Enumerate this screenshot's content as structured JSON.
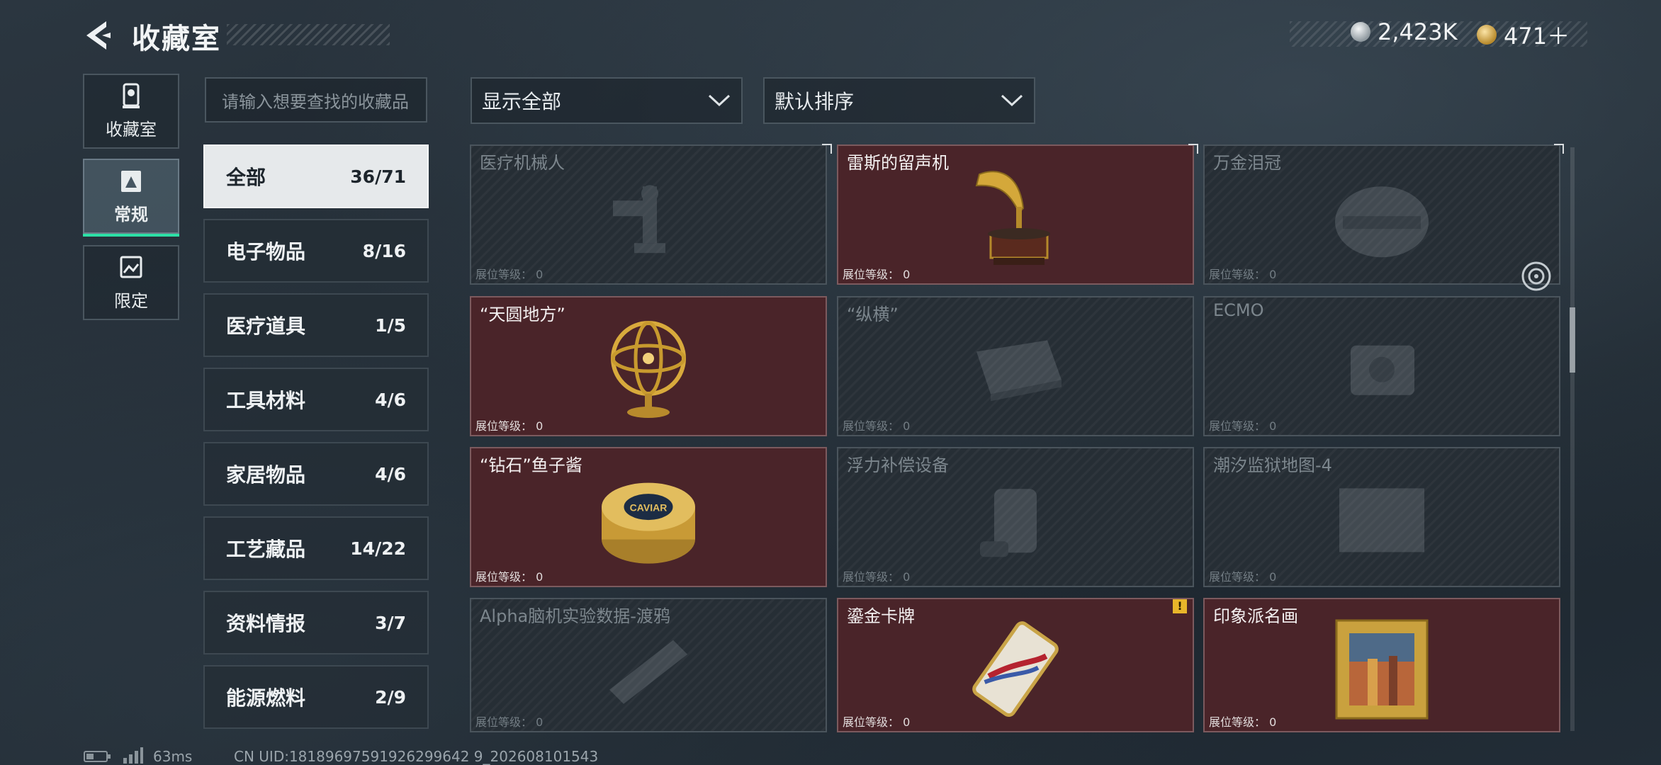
{
  "header": {
    "title": "收藏室"
  },
  "currency": [
    {
      "icon": "silver-coin-icon",
      "value": "2,423K"
    },
    {
      "icon": "gold-coin-icon",
      "value": "471＋"
    }
  ],
  "side_nav": [
    {
      "label": "收藏室",
      "icon": "trophy-icon",
      "active": false
    },
    {
      "label": "常规",
      "icon": "display-stand-icon",
      "active": true
    },
    {
      "label": "限定",
      "icon": "landscape-frame-icon",
      "active": false
    }
  ],
  "search": {
    "placeholder": "请输入想要查找的收藏品"
  },
  "filters": {
    "display": "显示全部",
    "sort": "默认排序"
  },
  "categories": [
    {
      "label": "全部",
      "count": "36/71",
      "active": true
    },
    {
      "label": "电子物品",
      "count": "8/16",
      "active": false
    },
    {
      "label": "医疗道具",
      "count": "1/5",
      "active": false
    },
    {
      "label": "工具材料",
      "count": "4/6",
      "active": false
    },
    {
      "label": "家居物品",
      "count": "4/6",
      "active": false
    },
    {
      "label": "工艺藏品",
      "count": "14/22",
      "active": false
    },
    {
      "label": "资料情报",
      "count": "3/7",
      "active": false
    },
    {
      "label": "能源燃料",
      "count": "2/9",
      "active": false
    }
  ],
  "level_label": "展位等级：",
  "items": [
    {
      "name": "医疗机械人",
      "level": "0",
      "owned": false,
      "art": "robot-arm-icon"
    },
    {
      "name": "雷斯的留声机",
      "level": "0",
      "owned": true,
      "art": "gramophone-icon"
    },
    {
      "name": "万金泪冠",
      "level": "0",
      "owned": false,
      "art": "crown-icon"
    },
    {
      "name": "“天圆地方”",
      "level": "0",
      "owned": true,
      "art": "armillary-sphere-icon"
    },
    {
      "name": "“纵横”",
      "level": "0",
      "owned": false,
      "art": "chessboard-icon"
    },
    {
      "name": "ECMO",
      "level": "0",
      "owned": false,
      "art": "ecmo-machine-icon"
    },
    {
      "name": "“钻石”鱼子酱",
      "level": "0",
      "owned": true,
      "art": "caviar-tin-icon",
      "art_text": "CAVIAR"
    },
    {
      "name": "浮力补偿设备",
      "level": "0",
      "owned": false,
      "art": "buoyancy-vest-icon"
    },
    {
      "name": "潮汐监狱地图-4",
      "level": "0",
      "owned": false,
      "art": "map-icon"
    },
    {
      "name": "Alpha脑机实验数据-渡鸦",
      "level": "0",
      "owned": false,
      "art": "data-drive-icon"
    },
    {
      "name": "鎏金卡牌",
      "level": "0",
      "owned": true,
      "art": "gilded-card-icon",
      "badge": "!"
    },
    {
      "name": "印象派名画",
      "level": "0",
      "owned": true,
      "art": "framed-painting-icon"
    }
  ],
  "status_bar": {
    "ping": "63ms",
    "uid": "CN UID:18189697591926299642 9_202608101543"
  },
  "colors": {
    "accent": "#2de0a6",
    "owned_card": "#4a2429",
    "locked_card": "#262e35"
  }
}
